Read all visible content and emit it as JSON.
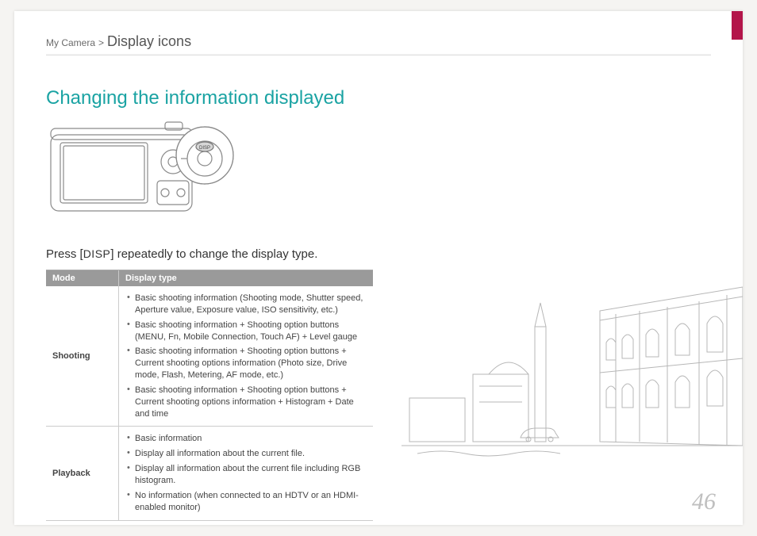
{
  "breadcrumb": {
    "section": "My Camera",
    "sep": ">",
    "page": "Display icons"
  },
  "title": "Changing the information displayed",
  "instruction": {
    "pre": "Press [",
    "key": "DISP",
    "post": "] repeatedly to change the display type."
  },
  "table": {
    "headers": {
      "mode": "Mode",
      "displayType": "Display type"
    },
    "rows": [
      {
        "mode": "Shooting",
        "items": [
          "Basic shooting information (Shooting mode, Shutter speed, Aperture value, Exposure value, ISO sensitivity, etc.)",
          "Basic shooting information + Shooting option buttons (MENU, Fn, Mobile Connection, Touch AF) + Level gauge",
          "Basic shooting information + Shooting option buttons + Current shooting options information (Photo size, Drive mode, Flash, Metering, AF mode, etc.)",
          "Basic shooting information + Shooting option buttons + Current shooting options information + Histogram + Date and time"
        ]
      },
      {
        "mode": "Playback",
        "items": [
          "Basic information",
          "Display all information about the current file.",
          "Display all information about the current file including RGB histogram.",
          "No information (when connected to an HDTV or an HDMI-enabled monitor)"
        ]
      }
    ]
  },
  "pageNumber": "46",
  "icons": {
    "dispButtonLabel": "DISP"
  }
}
